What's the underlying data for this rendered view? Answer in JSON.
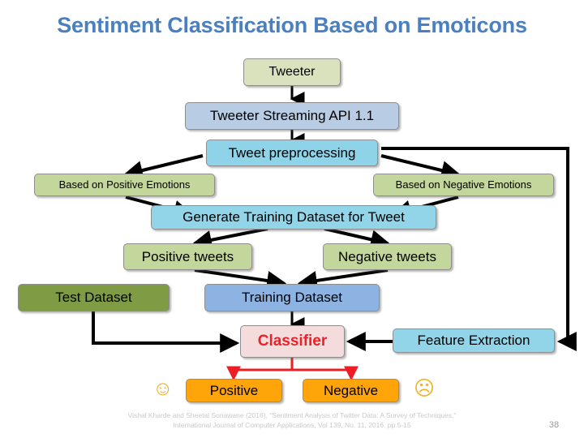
{
  "slide": {
    "title": "Sentiment Classification Based on Emoticons",
    "title_color": "#4a80bf",
    "background": "#ffffff",
    "page_number": "38"
  },
  "nodes": {
    "tweeter": {
      "label": "Tweeter",
      "fill": "#d9e2bc"
    },
    "streaming_api": {
      "label": "Tweeter Streaming API 1.1",
      "fill": "#b8cce4"
    },
    "preprocessing": {
      "label": "Tweet preprocessing",
      "fill": "#8fd3e8"
    },
    "positive_emotions": {
      "label": "Based on Positive Emotions",
      "fill": "#c3d69b"
    },
    "negative_emotions": {
      "label": "Based on Negative Emotions",
      "fill": "#c3d69b"
    },
    "generate_training": {
      "label": "Generate Training Dataset for Tweet",
      "fill": "#92d5e9"
    },
    "positive_tweets": {
      "label": "Positive tweets",
      "fill": "#c3d69b"
    },
    "negative_tweets": {
      "label": "Negative tweets",
      "fill": "#c3d69b"
    },
    "test_dataset": {
      "label": "Test Dataset",
      "fill": "#7f9c44"
    },
    "training_dataset": {
      "label": "Training Dataset",
      "fill": "#8db3e2"
    },
    "classifier": {
      "label": "Classifier",
      "fill": "#f5dcdc",
      "text_color": "#e8232a"
    },
    "feature_extraction": {
      "label": "Feature Extraction",
      "fill": "#92d5e9"
    },
    "positive_result": {
      "label": "Positive",
      "fill": "#ffa409"
    },
    "negative_result": {
      "label": "Negative",
      "fill": "#ffa409"
    }
  },
  "emoticons": {
    "happy": "☺",
    "sad": "☹"
  },
  "footer": {
    "citation_line1": "Vishal Kharde and Sheetal Sonawane (2016), \"Sentiment Analysis of Twitter Data: A Survey of Techniques,\"",
    "citation_line2": "International Journal of Computer Applications, Vol 139, No. 11, 2016. pp.5-15"
  }
}
